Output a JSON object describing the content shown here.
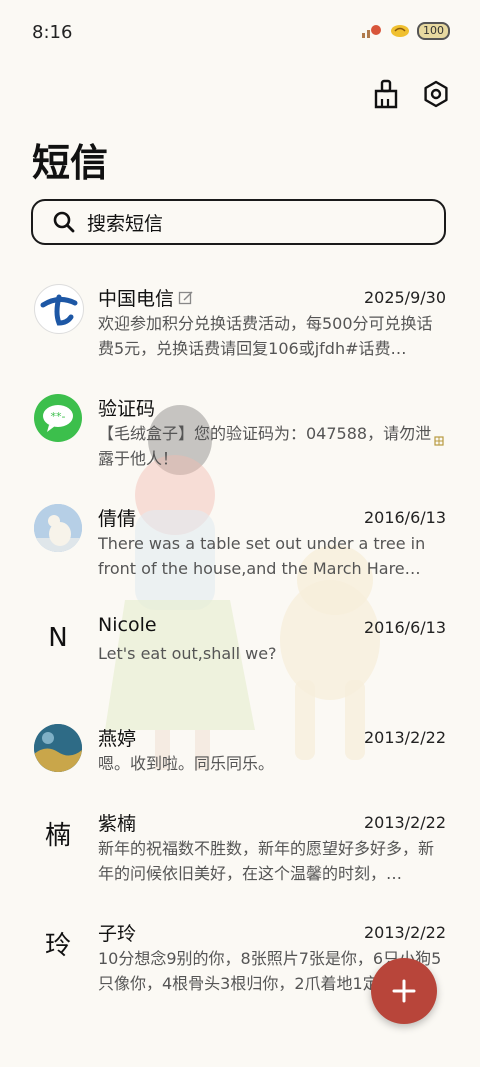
{
  "status": {
    "time": "8:16",
    "battery": "100"
  },
  "header": {
    "title": "短信"
  },
  "search": {
    "placeholder": "搜索短信"
  },
  "conversations": [
    {
      "name": "中国电信",
      "date": "2025/9/30",
      "preview": "欢迎参加积分兑换话费活动，每500分可兑换话费5元，兑换话费请回复106或jfdh#话费…",
      "avatar": "china-telecom-logo",
      "edited": true
    },
    {
      "name": "验证码",
      "date": "",
      "preview": "【毛绒盒子】您的验证码为：047588，请勿泄露于他人！",
      "avatar": "message-bubble-icon"
    },
    {
      "name": "倩倩",
      "date": "2016/6/13",
      "preview": "There was a table set out under a tree in front of the house,and the March Hare an…",
      "avatar": "polar-bear-photo"
    },
    {
      "name": "Nicole",
      "date": "2016/6/13",
      "preview": "Let's eat out,shall we?",
      "avatar_letter": "N"
    },
    {
      "name": "燕婷",
      "date": "2013/2/22",
      "preview": "嗯。收到啦。同乐同乐。",
      "avatar": "landscape-photo"
    },
    {
      "name": "紫楠",
      "date": "2013/2/22",
      "preview": "新年的祝福数不胜数，新年的愿望好多好多，新年的问候依旧美好，在这个温馨的时刻，…",
      "avatar_letter": "楠"
    },
    {
      "name": "子玲",
      "date": "2013/2/22",
      "preview": "10分想念9别的你，8张照片7张是你，6只小狗5只像你，4根骨头3根归你，2爪着地1定…",
      "avatar_letter": "玲"
    }
  ],
  "colors": {
    "accent": "#b8453a",
    "background": "#fbf9f4"
  }
}
